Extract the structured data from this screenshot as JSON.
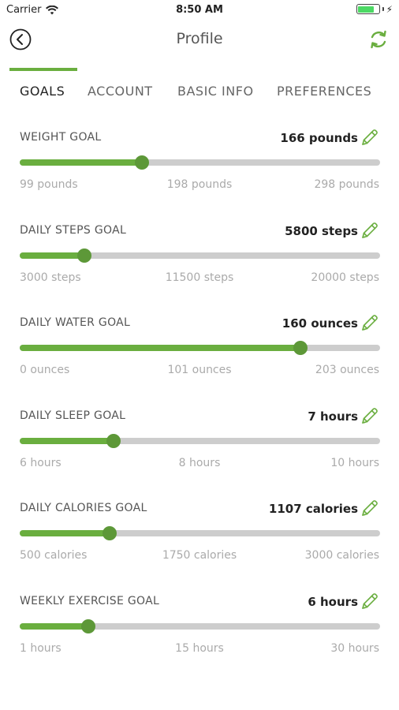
{
  "colors": {
    "accent": "#6aae3f",
    "thumb": "#5d9838",
    "track": "#cdcdcd",
    "battery": "#4cd964"
  },
  "status_bar": {
    "carrier": "Carrier",
    "time": "8:50 AM",
    "battery_level": 0.8
  },
  "header": {
    "title": "Profile",
    "back_icon": "back-arrow-circle-icon",
    "refresh_icon": "refresh-icon"
  },
  "tabs": [
    {
      "label": "GOALS",
      "active": true
    },
    {
      "label": "ACCOUNT",
      "active": false
    },
    {
      "label": "BASIC INFO",
      "active": false
    },
    {
      "label": "PREFERENCES",
      "active": false
    }
  ],
  "goals": [
    {
      "label": "WEIGHT GOAL",
      "value": "166 pounds",
      "fraction": 0.34,
      "min": "99 pounds",
      "mid": "198 pounds",
      "max": "298 pounds"
    },
    {
      "label": "DAILY STEPS GOAL",
      "value": "5800 steps",
      "fraction": 0.18,
      "min": "3000 steps",
      "mid": "11500 steps",
      "max": "20000 steps"
    },
    {
      "label": "DAILY WATER GOAL",
      "value": "160 ounces",
      "fraction": 0.78,
      "min": "0 ounces",
      "mid": "101 ounces",
      "max": "203 ounces"
    },
    {
      "label": "DAILY SLEEP GOAL",
      "value": "7 hours",
      "fraction": 0.26,
      "min": "6 hours",
      "mid": "8 hours",
      "max": "10 hours"
    },
    {
      "label": "DAILY CALORIES GOAL",
      "value": "1107 calories",
      "fraction": 0.25,
      "min": "500 calories",
      "mid": "1750 calories",
      "max": "3000 calories"
    },
    {
      "label": "WEEKLY EXERCISE GOAL",
      "value": "6 hours",
      "fraction": 0.19,
      "min": "1 hours",
      "mid": "15 hours",
      "max": "30 hours"
    }
  ],
  "edit_icon": "pencil-icon"
}
